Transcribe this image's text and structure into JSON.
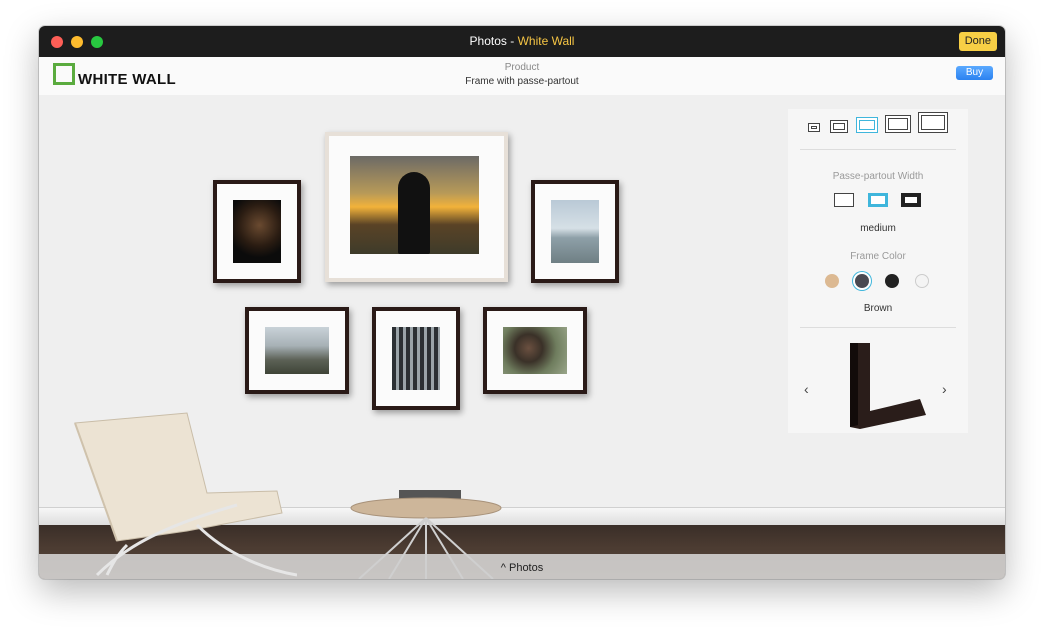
{
  "window": {
    "title_app": "Photos",
    "title_sep": " - ",
    "title_ext": "White Wall",
    "done_label": "Done",
    "traffic_lights": [
      "#fe5f57",
      "#febc2e",
      "#28c840"
    ]
  },
  "header": {
    "logo_text": "WHITE WALL",
    "product_label": "Product",
    "product_value": "Frame with passe-partout",
    "buy_label": "Buy"
  },
  "panel": {
    "passepartout_label": "Passe-partout Width",
    "passepartout_value": "medium",
    "frame_color_label": "Frame Color",
    "frame_color_value": "Brown",
    "prev_icon": "‹",
    "next_icon": "›",
    "frame_colors": [
      "#dcb992",
      "#4a4a52",
      "#222222",
      "#f4f4f4"
    ],
    "selected_color_index": 1,
    "selected_size_index": 2,
    "selected_passepartout_index": 1
  },
  "bottom": {
    "photos_label": "^ Photos"
  },
  "colors": {
    "accent_yellow": "#f6c544",
    "selection_blue": "#3fb6dc",
    "buy_blue": "#2b82f0",
    "logo_green": "#5aab3e"
  }
}
